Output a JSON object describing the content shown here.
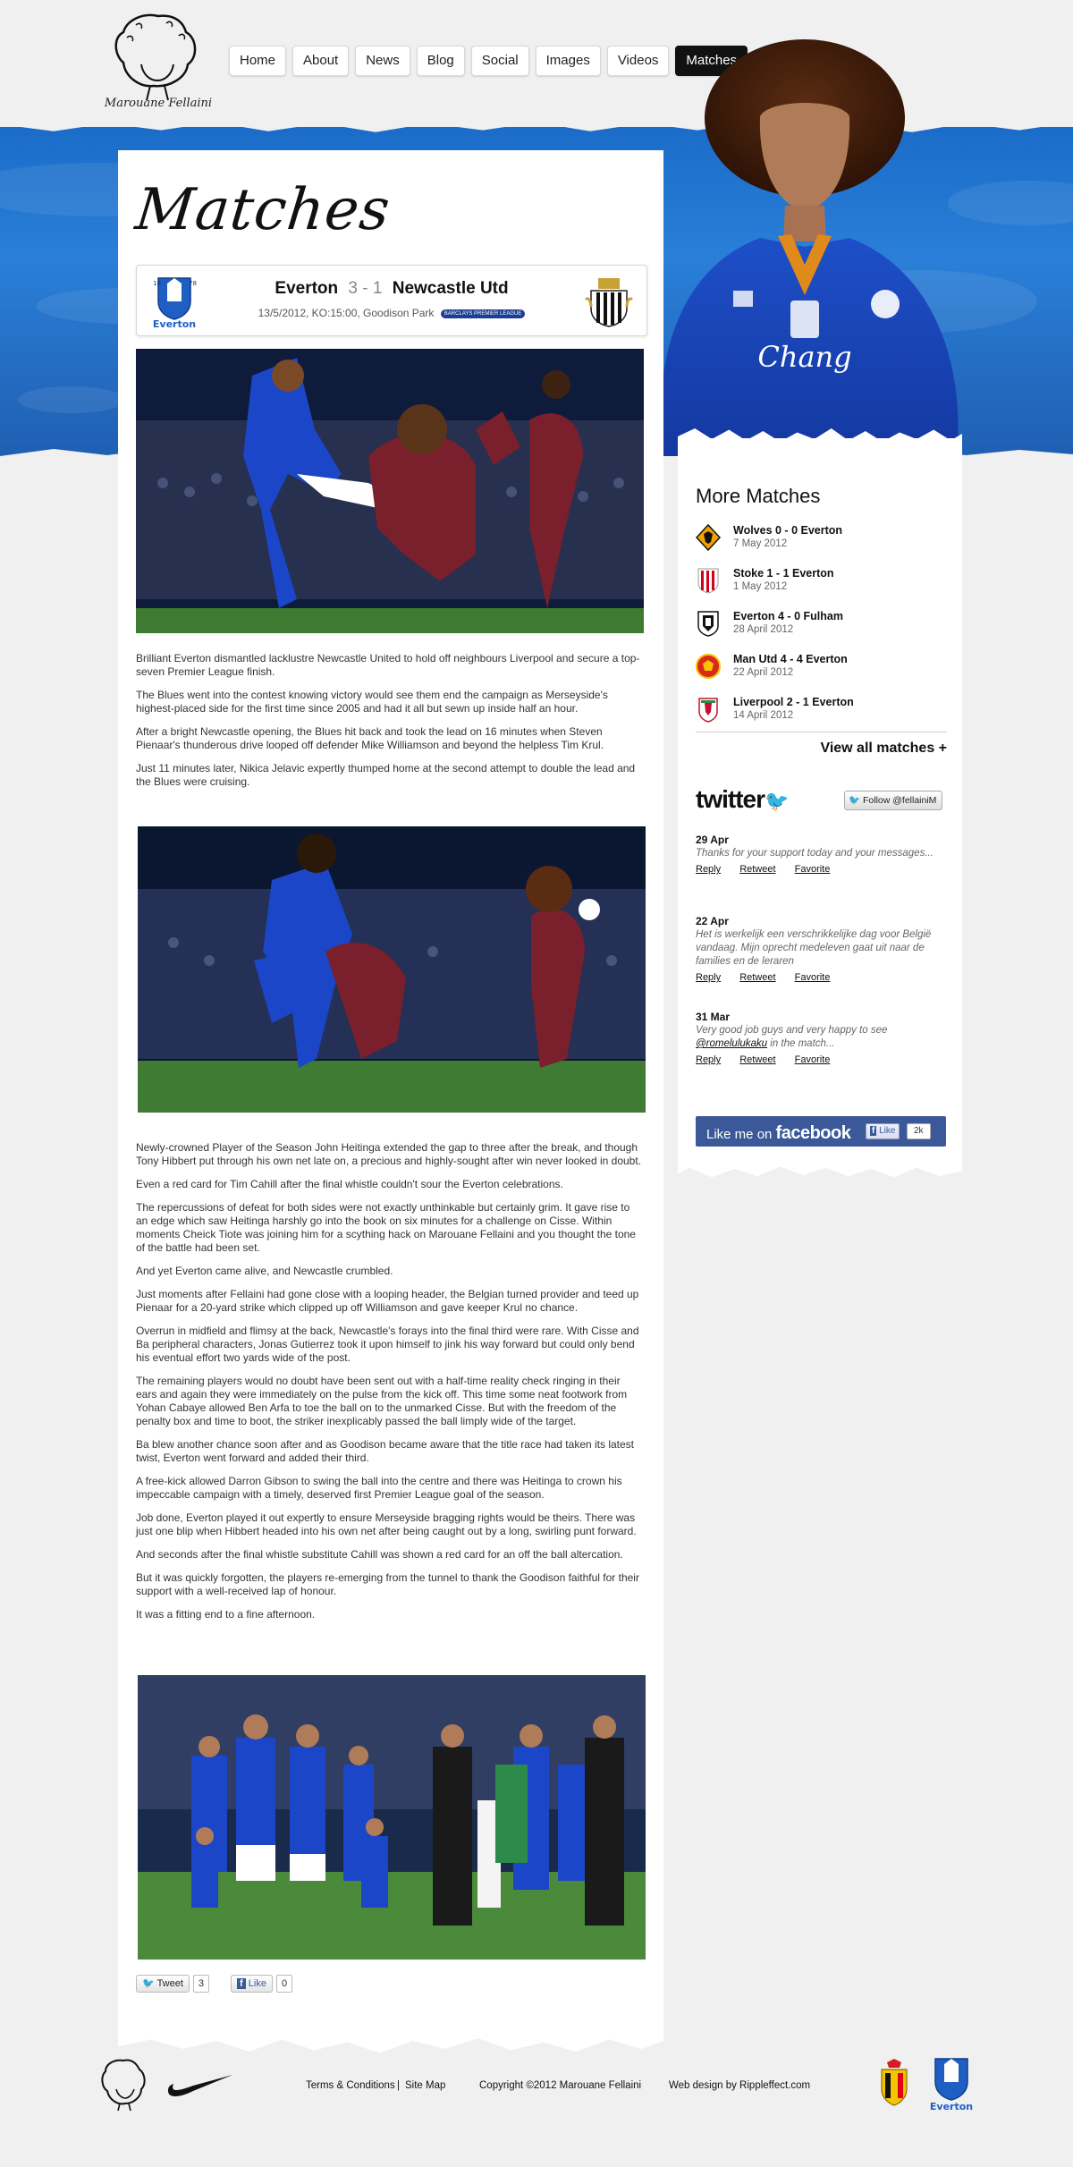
{
  "logo": {
    "text": "Marouane Fellaini"
  },
  "nav": {
    "items": [
      "Home",
      "About",
      "News",
      "Blog",
      "Social",
      "Images",
      "Videos",
      "Matches"
    ],
    "active": "Matches"
  },
  "page": {
    "title": "Matches"
  },
  "match": {
    "home": "Everton",
    "score": "3 - 1",
    "away": "Newcastle Utd",
    "info": "13/5/2012, KO:15:00, Goodison Park",
    "competition_badge": "BARCLAYS PREMIER LEAGUE",
    "home_crest_label": "Everton",
    "home_crest_years": [
      "18",
      "78"
    ]
  },
  "article": {
    "intro": [
      "Brilliant Everton dismantled lacklustre Newcastle United to hold off neighbours Liverpool and secure a top-seven Premier League finish.",
      "The Blues went into the contest knowing victory would see them end the campaign as Merseyside's highest-placed side for the first time since 2005 and had it all but sewn up inside half an hour.",
      "After a bright Newcastle opening, the Blues hit back and took the lead on 16 minutes when Steven Pienaar's thunderous drive looped off defender Mike Williamson and beyond the helpless Tim Krul.",
      "Just 11 minutes later, Nikica Jelavic expertly thumped home at the second attempt to double the lead and the Blues were cruising."
    ],
    "body": [
      "Newly-crowned Player of the Season John Heitinga extended the gap to three after the break, and though Tony Hibbert put through his own net late on, a precious and highly-sought after win never looked in doubt.",
      "Even a red card for Tim Cahill after the final whistle couldn't sour the Everton celebrations.",
      "The repercussions of defeat for both sides were not exactly unthinkable but certainly grim. It gave rise to an edge which saw Heitinga harshly go into the book on six minutes for a challenge on Cisse. Within moments Cheick Tiote was joining him for a scything hack on Marouane Fellaini and you thought the tone of the battle had been set.",
      "And yet Everton came alive, and Newcastle crumbled.",
      "Just moments after Fellaini had gone close with a looping header, the Belgian turned provider and teed up Pienaar for a 20-yard strike which clipped up off Williamson and gave keeper Krul no chance.",
      "Overrun in midfield and flimsy at the back, Newcastle's forays into the final third were rare. With Cisse and Ba peripheral characters, Jonas Gutierrez took it upon himself to jink his way forward but could only bend his eventual effort two yards wide of the post.",
      "The remaining players would no doubt have been sent out with a half-time reality check ringing in their ears and again they were immediately on the pulse from the kick off. This time some neat footwork from Yohan Cabaye allowed Ben Arfa to toe the ball on to the unmarked Cisse. But with the freedom of the penalty box and time to boot, the striker inexplicably passed the ball limply wide of the target.",
      "Ba blew another chance soon after and as Goodison became aware that the title race had taken its latest twist, Everton went forward and added their third.",
      "A free-kick allowed Darron Gibson to swing the ball into the centre and there was Heitinga to crown his impeccable campaign with a timely, deserved first Premier League goal of the season.",
      "Job done, Everton played it out expertly to ensure Merseyside bragging rights would be theirs. There was just one blip when Hibbert headed into his own net after being caught out by a long, swirling punt forward.",
      "And seconds after the final whistle substitute Cahill was shown a red card for an off the ball altercation.",
      "But it was quickly forgotten, the players re-emerging from the tunnel to thank the Goodison faithful for their support with a well-received lap of honour.",
      "It was a fitting end to a fine afternoon."
    ]
  },
  "share": {
    "tweet_label": "Tweet",
    "tweet_count": "3",
    "like_label": "Like",
    "like_count": "0"
  },
  "sidebar": {
    "heading": "More Matches",
    "matches": [
      {
        "teams": "Wolves  0 - 0  Everton",
        "date": "7 May 2012",
        "badge": "wolves-badge",
        "color": "#f5a200"
      },
      {
        "teams": "Stoke  1 - 1  Everton",
        "date": "1 May 2012",
        "badge": "stoke-badge",
        "color": "#d6001c"
      },
      {
        "teams": "Everton  4 - 0  Fulham",
        "date": "28 April 2012",
        "badge": "fulham-badge",
        "color": "#111111"
      },
      {
        "teams": "Man Utd  4 - 4  Everton",
        "date": "22 April 2012",
        "badge": "man-utd-badge",
        "color": "#da291c"
      },
      {
        "teams": "Liverpool  2 - 1  Everton",
        "date": "14 April 2012",
        "badge": "liverpool-badge",
        "color": "#c8102e"
      }
    ],
    "view_all": "View all matches +",
    "twitter_logo": "twitter",
    "follow_label": "Follow @fellainiM",
    "tweets": [
      {
        "date": "29 Apr",
        "text": "Thanks for your support today and your messages...",
        "mention": "",
        "after": ""
      },
      {
        "date": "22 Apr",
        "text": "Het is werkelijk een verschrikkelijke dag voor België vandaag. Mijn oprecht medeleven gaat uit naar de families en de leraren",
        "mention": "",
        "after": ""
      },
      {
        "date": "31 Mar",
        "text": "Very good job guys and very happy to see",
        "mention": "@romelulukaku",
        "after": " in the match..."
      }
    ],
    "tweet_actions": [
      "Reply",
      "Retweet",
      "Favorite"
    ],
    "facebook": {
      "prefix": "Like me on",
      "brand": "facebook",
      "like": "Like",
      "count": "2k"
    }
  },
  "footer": {
    "terms": "Terms & Conditions",
    "separator": "|",
    "sitemap": "Site Map",
    "copyright": "Copyright ©2012 Marouane Fellaini",
    "credit": "Web design by Rippleffect.com",
    "everton_label": "Everton"
  },
  "colors": {
    "accent_blue": "#1a6cc8",
    "facebook_blue": "#3b5998",
    "nav_active": "#111111"
  }
}
